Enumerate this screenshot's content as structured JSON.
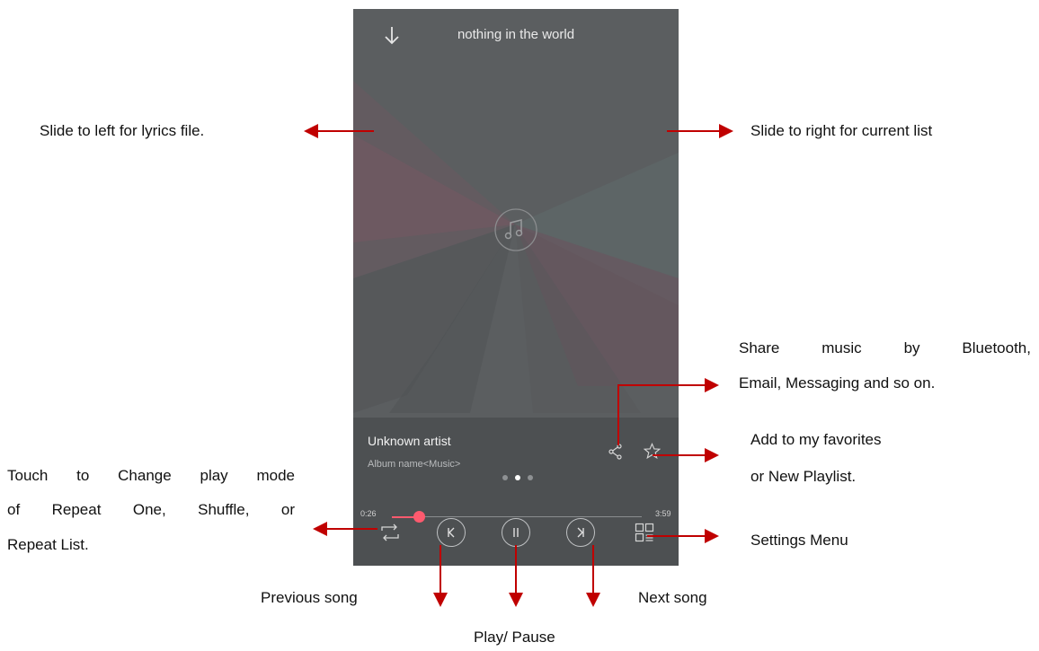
{
  "player": {
    "title": "nothing in the world",
    "artist": "Unknown artist",
    "album": "Album name<Music>",
    "elapsed": "0:26",
    "duration": "3:59",
    "progress": 0.11,
    "page_dots": 3,
    "active_dot": 1,
    "icons": [
      "down-arrow-icon",
      "music-note-icon",
      "share-icon",
      "star-icon",
      "repeat-icon",
      "previous-icon",
      "pause-icon",
      "next-icon",
      "settings-grid-icon"
    ],
    "accent_color": "#ff5a6e"
  },
  "annotations": {
    "left_slide": "Slide to left for lyrics file.",
    "right_slide": "Slide to right for current list",
    "share_line1": "Share music by Bluetooth,",
    "share_line2": "Email, Messaging and so on.",
    "fav_line1": "Add to my favorites",
    "fav_line2": "or New Playlist.",
    "mode_line1": "Touch to Change play mode",
    "mode_line2": "of Repeat One, Shuffle, or",
    "mode_line3": "Repeat List.",
    "settings": "Settings Menu",
    "previous": "Previous song",
    "play_pause": "Play/ Pause",
    "next": "Next song"
  },
  "arrow_color": "#c00000"
}
